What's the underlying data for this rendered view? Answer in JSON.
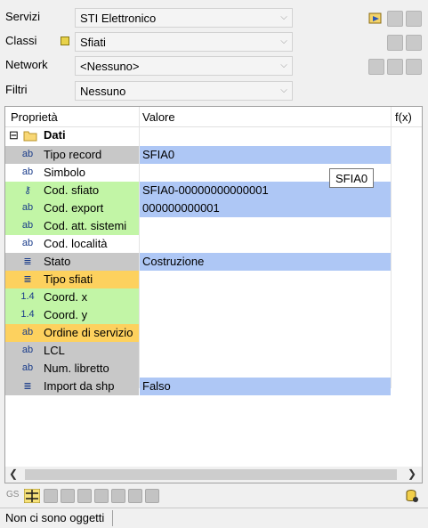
{
  "filters": {
    "servizi": {
      "label": "Servizi",
      "value": "STI Elettronico"
    },
    "classi": {
      "label": "Classi",
      "value": "Sfiati"
    },
    "network": {
      "label": "Network",
      "value": "<Nessuno>"
    },
    "filtri": {
      "label": "Filtri",
      "value": "Nessuno"
    }
  },
  "grid": {
    "col_property": "Proprietà",
    "col_value": "Valore",
    "col_fx": "f(x)",
    "group": {
      "expander": "⊟",
      "label": "Dati"
    },
    "rows": [
      {
        "icon": "ab",
        "name": "Tipo record",
        "value": "SFIA0",
        "name_color": "#c8c8c8",
        "value_color": "#aec7f5"
      },
      {
        "icon": "ab",
        "name": "Simbolo",
        "value": "",
        "name_color": "#ffffff",
        "value_color": "#ffffff"
      },
      {
        "icon": "key",
        "name": "Cod. sfiato",
        "value": "SFIA0-00000000000001",
        "name_color": "#c2f5a6",
        "value_color": "#aec7f5"
      },
      {
        "icon": "ab",
        "name": "Cod. export",
        "value": "000000000001",
        "name_color": "#c2f5a6",
        "value_color": "#aec7f5"
      },
      {
        "icon": "ab",
        "name": "Cod. att. sistemi",
        "value": "",
        "name_color": "#c2f5a6",
        "value_color": "#ffffff"
      },
      {
        "icon": "ab",
        "name": "Cod. località",
        "value": "",
        "name_color": "#ffffff",
        "value_color": "#ffffff"
      },
      {
        "icon": "list",
        "name": "Stato",
        "value": "Costruzione",
        "name_color": "#c8c8c8",
        "value_color": "#aec7f5"
      },
      {
        "icon": "list",
        "name": "Tipo sfiati",
        "value": "",
        "name_color": "#fdd15e",
        "value_color": "#ffffff"
      },
      {
        "icon": "1.4",
        "name": "Coord. x",
        "value": "",
        "name_color": "#c2f5a6",
        "value_color": "#ffffff"
      },
      {
        "icon": "1.4",
        "name": "Coord. y",
        "value": "",
        "name_color": "#c2f5a6",
        "value_color": "#ffffff"
      },
      {
        "icon": "ab",
        "name": "Ordine di servizio",
        "value": "",
        "name_color": "#fdd15e",
        "value_color": "#ffffff"
      },
      {
        "icon": "ab",
        "name": "LCL",
        "value": "",
        "name_color": "#c8c8c8",
        "value_color": "#ffffff"
      },
      {
        "icon": "ab",
        "name": "Num. libretto",
        "value": "",
        "name_color": "#c8c8c8",
        "value_color": "#ffffff"
      },
      {
        "icon": "list",
        "name": "Import da shp",
        "value": "Falso",
        "name_color": "#c8c8c8",
        "value_color": "#aec7f5"
      }
    ]
  },
  "tooltip": "SFIA0",
  "bottom_toolbar": {
    "gs_label": "GS"
  },
  "status": {
    "text": "Non ci sono oggetti"
  }
}
